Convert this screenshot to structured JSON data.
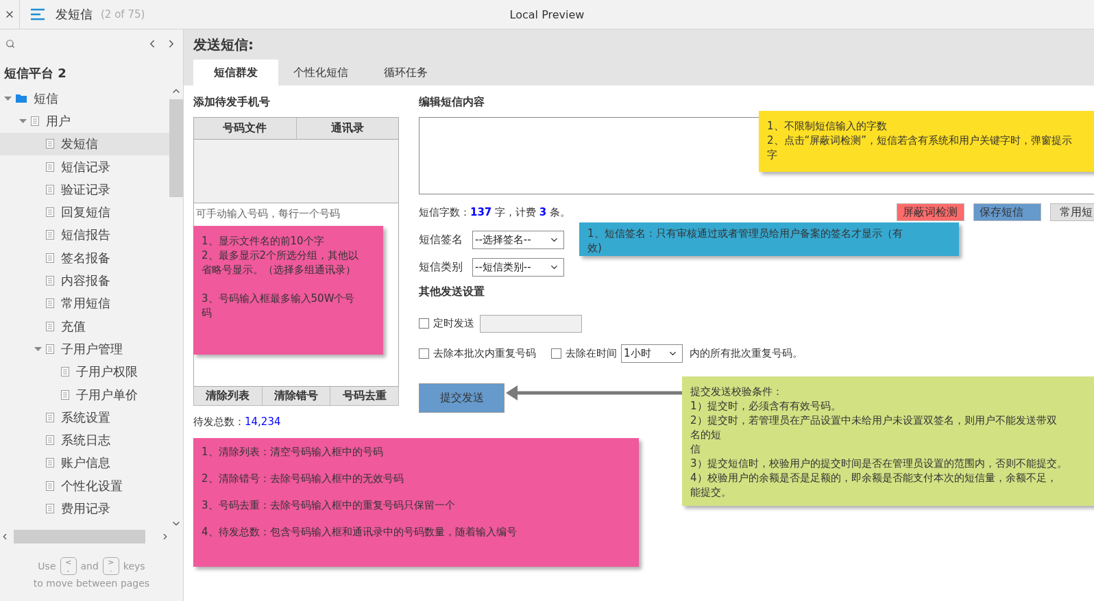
{
  "topbar": {
    "page_title": "发短信",
    "page_count": "(2 of 75)",
    "preview_title": "Local Preview"
  },
  "sidebar": {
    "project": "短信平台 2",
    "tree": [
      {
        "label": "短信",
        "kind": "folder",
        "expanded": true,
        "selected": false,
        "children": [
          {
            "label": "用户",
            "kind": "page",
            "expanded": true,
            "selected": false,
            "children": [
              {
                "label": "发短信",
                "kind": "page",
                "selected": true
              },
              {
                "label": "短信记录",
                "kind": "page",
                "selected": false
              },
              {
                "label": "验证记录",
                "kind": "page",
                "selected": false
              },
              {
                "label": "回复短信",
                "kind": "page",
                "selected": false
              },
              {
                "label": "短信报告",
                "kind": "page",
                "selected": false
              },
              {
                "label": "签名报备",
                "kind": "page",
                "selected": false
              },
              {
                "label": "内容报备",
                "kind": "page",
                "selected": false
              },
              {
                "label": "常用短信",
                "kind": "page",
                "selected": false
              },
              {
                "label": "充值",
                "kind": "page",
                "selected": false
              },
              {
                "label": "子用户管理",
                "kind": "page",
                "expanded": true,
                "selected": false,
                "children": [
                  {
                    "label": "子用户权限",
                    "kind": "page",
                    "selected": false
                  },
                  {
                    "label": "子用户单价",
                    "kind": "page",
                    "selected": false
                  }
                ]
              },
              {
                "label": "系统设置",
                "kind": "page",
                "selected": false
              },
              {
                "label": "系统日志",
                "kind": "page",
                "selected": false
              },
              {
                "label": "账户信息",
                "kind": "page",
                "selected": false
              },
              {
                "label": "个性化设置",
                "kind": "page",
                "selected": false
              },
              {
                "label": "费用记录",
                "kind": "page",
                "selected": false
              }
            ]
          }
        ]
      }
    ],
    "footer": {
      "use": "Use",
      "and": "and",
      "keys": "keys",
      "line2": "to move between pages",
      "key_prev": {
        "top": "<",
        "bottom": ","
      },
      "key_next": {
        "top": ">",
        "bottom": "."
      }
    }
  },
  "page": {
    "title": "发送短信:",
    "tabs": [
      {
        "label": "短信群发",
        "selected": true
      },
      {
        "label": "个性化短信",
        "selected": false
      },
      {
        "label": "循环任务",
        "selected": false
      }
    ],
    "left": {
      "heading": "添加待发手机号",
      "source_tabs": [
        "号码文件",
        "通讯录"
      ],
      "placeholder": "可手动输入号码，每行一个号码",
      "actions": [
        "清除列表",
        "清除错号",
        "号码去重"
      ],
      "total_label": "待发总数：",
      "total_value": "14,234"
    },
    "right": {
      "heading": "编辑短信内容",
      "count_text": "短信字数：**137** 字，计费 **3** 条。",
      "buttons": [
        {
          "label": "屏蔽词检测",
          "kind": "danger"
        },
        {
          "label": "保存短信",
          "kind": "primary"
        },
        {
          "label": "常用短",
          "kind": "default"
        }
      ],
      "fields": [
        {
          "label": "短信签名",
          "value": "--选择签名--"
        },
        {
          "label": "短信类别",
          "value": "--短信类别--"
        }
      ],
      "other_heading": "其他发送设置",
      "schedule": {
        "label": "定时发送",
        "checked": false
      },
      "dedupe_batch": {
        "label": "去除本批次内重复号码",
        "checked": false
      },
      "dedupe_time": {
        "label": "去除在时间",
        "checked": false,
        "value": "1小时",
        "suffix": "内的所有批次重复号码。"
      },
      "submit": "提交发送"
    },
    "notes": [
      {
        "color": "#f0599c",
        "paragraphs": [
          [
            "1、显示文件名的前10个字",
            "2、最多显示2个所选分组，其他以",
            "省略号显示。（选择多组通讯录）"
          ],
          [
            "3、号码输入框最多输入50W个号",
            "码"
          ]
        ]
      },
      {
        "color": "#f0599c",
        "paragraphs": [
          [
            "1、清除列表：清空号码输入框中的号码"
          ],
          [
            "2、清除错号：去除号码输入框中的无效号码"
          ],
          [
            "3、号码去重：去除号码输入框中的重复号码只保留一个"
          ],
          [
            "4、待发总数：包含号码输入框和通讯录中的号码数量，随着输入编号"
          ]
        ]
      },
      {
        "color": "#fddf25",
        "paragraphs": [
          [
            "1、不限制短信输入的字数",
            "2、点击“屏蔽词检测”，短信若含有系统和用户关键字时，弹窗提示",
            "字"
          ]
        ]
      },
      {
        "color": "#36a9d1",
        "paragraphs": [
          [
            "1、短信签名：只有审核通过或者管理员给用户备案的签名才显示（有",
            "效)"
          ]
        ]
      },
      {
        "color": "#d2e283",
        "paragraphs": [
          [
            "提交发送校验条件：",
            "1）提交时，必须含有有效号码。",
            "2）提交时，若管理员在产品设置中未给用户未设置双签名，则用户不能发送带双",
            "名的短",
            "信",
            "3）提交短信时，校验用户的提交时间是否在管理员设置的范围内，否则不能提交。",
            "4）校验用户的余额是否是足额的，即余额是否能支付本次的短信量，余额不足，",
            "能提交。"
          ]
        ]
      }
    ]
  }
}
